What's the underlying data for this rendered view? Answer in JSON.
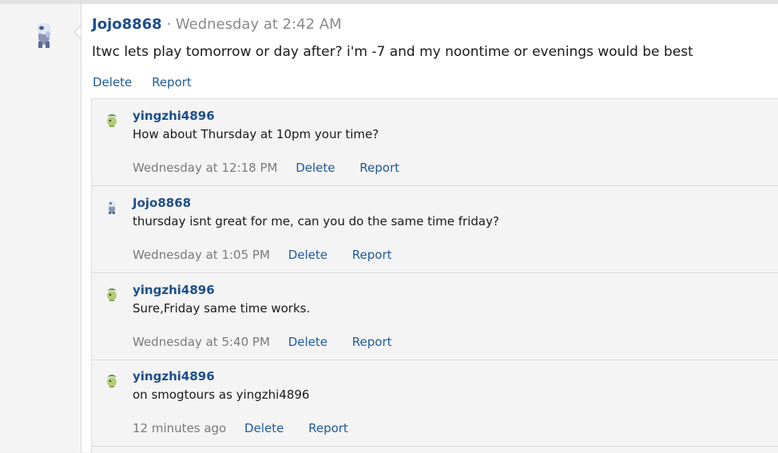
{
  "post": {
    "username": "Jojo8868",
    "separator": "·",
    "time": "Wednesday at 2:42 AM",
    "body": "Itwc lets play tomorrow or day after? i'm -7 and my noontime or evenings would be best",
    "delete_label": "Delete",
    "report_label": "Report",
    "avatar_icon": "pokemon-avatar-icon"
  },
  "comments": [
    {
      "username": "yingzhi4896",
      "text": "How about Thursday at 10pm your time?",
      "time": "Wednesday at 12:18 PM",
      "delete_label": "Delete",
      "report_label": "Report",
      "avatar_icon": "green-pokemon-avatar-icon"
    },
    {
      "username": "Jojo8868",
      "text": "thursday isnt great for me, can you do the same time friday?",
      "time": "Wednesday at 1:05 PM",
      "delete_label": "Delete",
      "report_label": "Report",
      "avatar_icon": "pokemon-avatar-icon"
    },
    {
      "username": "yingzhi4896",
      "text": "Sure,Friday same time works.",
      "time": "Wednesday at 5:40 PM",
      "delete_label": "Delete",
      "report_label": "Report",
      "avatar_icon": "green-pokemon-avatar-icon"
    },
    {
      "username": "yingzhi4896",
      "text": "on smogtours as yingzhi4896",
      "time": "12 minutes ago",
      "delete_label": "Delete",
      "report_label": "Report",
      "avatar_icon": "green-pokemon-avatar-icon"
    }
  ],
  "colors": {
    "link": "#1e5a9a",
    "username": "#1e4f8a",
    "meta": "#7a7a7a"
  }
}
